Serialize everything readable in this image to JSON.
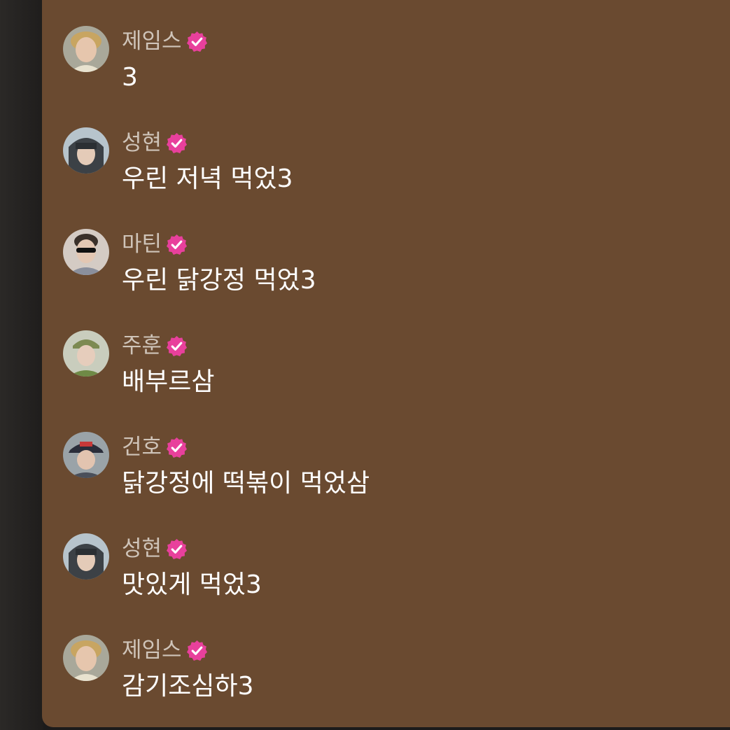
{
  "messages": [
    {
      "author": "제임스",
      "text": "3",
      "avatar": "avatar-james"
    },
    {
      "author": "성현",
      "text": "우린 저녁 먹었3",
      "avatar": "avatar-sunghyun"
    },
    {
      "author": "마틴",
      "text": "우린 닭강정 먹었3",
      "avatar": "avatar-martin"
    },
    {
      "author": "주훈",
      "text": "배부르삼",
      "avatar": "avatar-juhoon"
    },
    {
      "author": "건호",
      "text": "닭강정에 떡볶이 먹었삼",
      "avatar": "avatar-keonho"
    },
    {
      "author": "성현",
      "text": "맛있게 먹었3",
      "avatar": "avatar-sunghyun"
    },
    {
      "author": "제임스",
      "text": "감기조심하3",
      "avatar": "avatar-james"
    }
  ],
  "colors": {
    "panel_background": "#6a4a30",
    "author_name": "#cfc4b9",
    "message_text": "#ffffff",
    "verified_badge": "#e8409c"
  },
  "icons": {
    "verified": "verified-badge-icon"
  }
}
